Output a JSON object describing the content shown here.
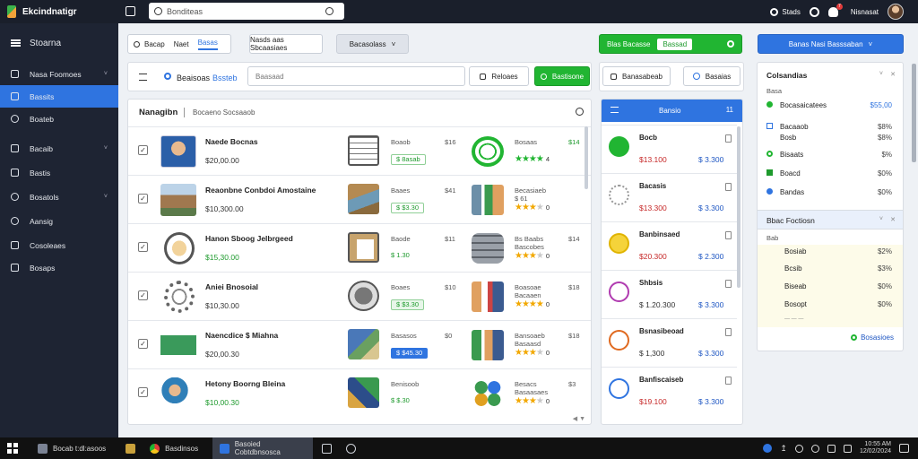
{
  "app": {
    "title": "Ekcindnatigr"
  },
  "search": {
    "value": "Bonditeas"
  },
  "topbar_right": {
    "stats": "Stads",
    "badge": "7",
    "user": "Nisnasat"
  },
  "sidebar": {
    "header": "Stoarna",
    "items": [
      {
        "label": "Nasa Foomoes",
        "icon": "box-icon",
        "chevron": "˅"
      },
      {
        "label": "Bassits",
        "icon": "stack-icon",
        "active": true
      },
      {
        "label": "Boateb",
        "icon": "circle-icon"
      },
      {
        "label": "Bacaib",
        "icon": "list-icon",
        "chevron": "˅"
      },
      {
        "label": "Bastis",
        "icon": "grid-icon"
      },
      {
        "label": "Bosatols",
        "icon": "info-icon",
        "chevron": "˅"
      },
      {
        "label": "Aansig",
        "icon": "gauge-icon"
      },
      {
        "label": "Cosoleaes",
        "icon": "chart-icon"
      },
      {
        "label": "Bosaps",
        "icon": "share-icon"
      }
    ]
  },
  "toolbar": {
    "tabs": [
      "Bacap",
      "Naet",
      "Basas"
    ],
    "tab_active": "Basas",
    "filter_text": "Nasds aas Sbcaasiaes",
    "dropdown": "Bacasolass",
    "green_group_a": "Blas Bacasse",
    "green_group_b": "Bassad",
    "blue_right": "Banas Nasi Basssaban"
  },
  "subtoolbar": {
    "label_a": "Beaisoas",
    "label_b": "Bssteb",
    "input_placeholder": "Baasaad",
    "filter_btn": "Reloaes",
    "green_btn": "Bastisone",
    "right_btn": "Banasabeab",
    "right_btn2": "Basaias"
  },
  "list": {
    "title": "Nanagibn",
    "subtitle": "Bocaeno Socsaaob",
    "rows": [
      {
        "name": "Naede Bocnas",
        "price": "$20,00.00",
        "col2": "Boaob",
        "col2b": "$16",
        "badge": "$ 8asab",
        "col3": "Bosaas",
        "col3b": "$14",
        "rating_label": "Baalaes",
        "stars": 4,
        "rating": "4"
      },
      {
        "name": "Reaonbne Conbdoi Amostaine",
        "price": "$10,300.00",
        "col2": "Baaes",
        "col2b": "$41",
        "badge": "$ $3.30",
        "col3": "Becasiaeb",
        "col3b": "",
        "rating_label": "$ 61",
        "stars": 3,
        "rating": "0"
      },
      {
        "name": "Hanon Sboog Jelbrgeed",
        "price": "$15,30.00",
        "col2": "Baode",
        "col2b": "$11",
        "badge": "$ 1.30",
        "col3": "Bs Baabs",
        "col3b": "$14",
        "rating_label": "Bascobes",
        "stars": 3,
        "rating": "0"
      },
      {
        "name": "Aniei Bnosoial",
        "price": "$10,30.00",
        "col2": "Boaes",
        "col2b": "$10",
        "badge": "$ $3.30",
        "col3": "Boasoae",
        "col3b": "$18",
        "rating_label": "Bacaaen",
        "stars": 4,
        "rating": "0"
      },
      {
        "name": "Naencdice $ Miahna",
        "price": "$20,00.30",
        "col2": "Basasos",
        "col2b": "$0",
        "badge": "$ $45.30",
        "col3": "Bansoaeb",
        "col3b": "$18",
        "rating_label": "Basaasd",
        "stars": 3,
        "rating": "0"
      },
      {
        "name": "Hetony Boorng Bleina",
        "price": "$10,00.30",
        "col2": "Benisoob",
        "col2b": "",
        "badge": "$ $.30",
        "col3": "Besacs",
        "col3b": "$3",
        "rating_label": "Basaasaes",
        "stars": 3,
        "rating": "0"
      }
    ]
  },
  "cards": {
    "header": "Bansio",
    "header_count": "11",
    "items": [
      {
        "name": "Bocb",
        "old": "$13.100",
        "new": "$ 3.300",
        "icon": "check-icon"
      },
      {
        "name": "Bacasis",
        "old": "$13.300",
        "new": "$ 3.300",
        "icon": "settings-icon"
      },
      {
        "name": "Banbinsaed",
        "old": "$20.300",
        "new": "$ 2.300",
        "icon": "coin-icon"
      },
      {
        "name": "Shbsis",
        "old": "$ 1.20.300",
        "new": "$ 3.300",
        "icon": "palette-icon"
      },
      {
        "name": "Bsnasibeoad",
        "old": "$ 1,300",
        "new": "$ 3.300",
        "icon": "flame-icon"
      },
      {
        "name": "Banfiscaiseb",
        "old": "$19.100",
        "new": "$ 3.300",
        "icon": "globe-icon"
      }
    ]
  },
  "far_right": {
    "section1_title": "Colsandias",
    "section1_sub": "Basa",
    "section1_items": [
      {
        "label": "Bocasaicatees",
        "value": "$55,00",
        "highlight": true
      },
      {
        "label": "Bacaaob",
        "value": "$8%"
      },
      {
        "label": "Bosb",
        "value": "$8%"
      },
      {
        "label": "Bisaats",
        "value": "$%"
      },
      {
        "label": "Boacd",
        "value": "$0%"
      },
      {
        "label": "Bandas",
        "value": "$0%"
      }
    ],
    "section2_title": "Bbac Foctiosn",
    "section2_sub": "Bab",
    "section2_items": [
      {
        "label": "Bosiab",
        "value": "$2%"
      },
      {
        "label": "Bcsib",
        "value": "$3%"
      },
      {
        "label": "Biseab",
        "value": "$0%"
      },
      {
        "label": "Bosopt",
        "value": "$0%"
      }
    ],
    "section2_footer_left": "— — —",
    "section2_footer_link": "Bosasioes"
  },
  "taskbar": {
    "apps": [
      {
        "label": "Bocab t:dl:asoos",
        "color": "#7b8394"
      },
      {
        "label": "",
        "color": "#c9a13b"
      },
      {
        "label": "Basdinsos",
        "color": "#e0a020"
      },
      {
        "label": "Basoied Cobtdbnsosca",
        "color": "#2f74e0",
        "active": true
      },
      {
        "label": "",
        "color": "#cfd3da"
      },
      {
        "label": "",
        "color": "#cfd3da"
      }
    ],
    "clock_time": "10:55 AM",
    "clock_date": "12/02/2024"
  },
  "colors": {
    "accent": "#2f74e0",
    "green": "#21b532",
    "sidebar": "#1e2433",
    "topbar": "#1a1f2b"
  }
}
